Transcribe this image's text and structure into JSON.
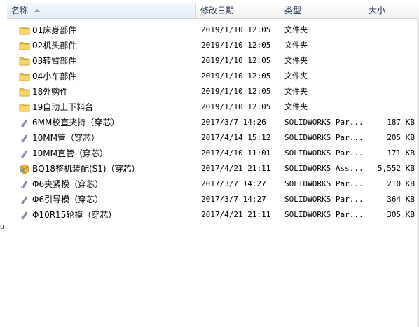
{
  "columns": {
    "name": "名称",
    "date": "修改日期",
    "type": "类型",
    "size": "大小"
  },
  "left_fragment": "u",
  "colors": {
    "folder": "#f0c24b",
    "part": "#9b8fb8",
    "assembly": "#f1b93a"
  },
  "rows": [
    {
      "name": "01床身部件",
      "date": "2019/1/10 12:05",
      "type": "文件夹",
      "size": "",
      "icon": "folder-icon"
    },
    {
      "name": "02机头部件",
      "date": "2019/1/10 12:05",
      "type": "文件夹",
      "size": "",
      "icon": "folder-icon"
    },
    {
      "name": "03转臂部件",
      "date": "2019/1/10 12:05",
      "type": "文件夹",
      "size": "",
      "icon": "folder-icon"
    },
    {
      "name": "04小车部件",
      "date": "2019/1/10 12:05",
      "type": "文件夹",
      "size": "",
      "icon": "folder-icon"
    },
    {
      "name": "18外购件",
      "date": "2019/1/10 12:05",
      "type": "文件夹",
      "size": "",
      "icon": "folder-icon"
    },
    {
      "name": "19自动上下料台",
      "date": "2019/1/10 12:05",
      "type": "文件夹",
      "size": "",
      "icon": "folder-icon"
    },
    {
      "name": "6MM校直夹持（穿芯）",
      "date": "2017/3/7 14:26",
      "type": "SOLIDWORKS Par...",
      "size": "187 KB",
      "icon": "solidworks-part-icon"
    },
    {
      "name": "10MM管（穿芯）",
      "date": "2017/4/14 15:12",
      "type": "SOLIDWORKS Par...",
      "size": "205 KB",
      "icon": "solidworks-part-icon"
    },
    {
      "name": "10MM直管（穿芯）",
      "date": "2017/4/10 11:01",
      "type": "SOLIDWORKS Par...",
      "size": "171 KB",
      "icon": "solidworks-part-icon"
    },
    {
      "name": "BQ18整机装配(S1)（穿芯）",
      "date": "2017/4/21 21:11",
      "type": "SOLIDWORKS Ass...",
      "size": "5,552 KB",
      "icon": "solidworks-assembly-icon"
    },
    {
      "name": "Φ6夹紧模（穿芯）",
      "date": "2017/3/7 14:27",
      "type": "SOLIDWORKS Par...",
      "size": "210 KB",
      "icon": "solidworks-part-icon"
    },
    {
      "name": "Φ6引导模（穿芯）",
      "date": "2017/3/7 14:27",
      "type": "SOLIDWORKS Par...",
      "size": "364 KB",
      "icon": "solidworks-part-icon"
    },
    {
      "name": "Φ10R15轮模（穿芯）",
      "date": "2017/4/21 21:11",
      "type": "SOLIDWORKS Par...",
      "size": "305 KB",
      "icon": "solidworks-part-icon"
    }
  ]
}
